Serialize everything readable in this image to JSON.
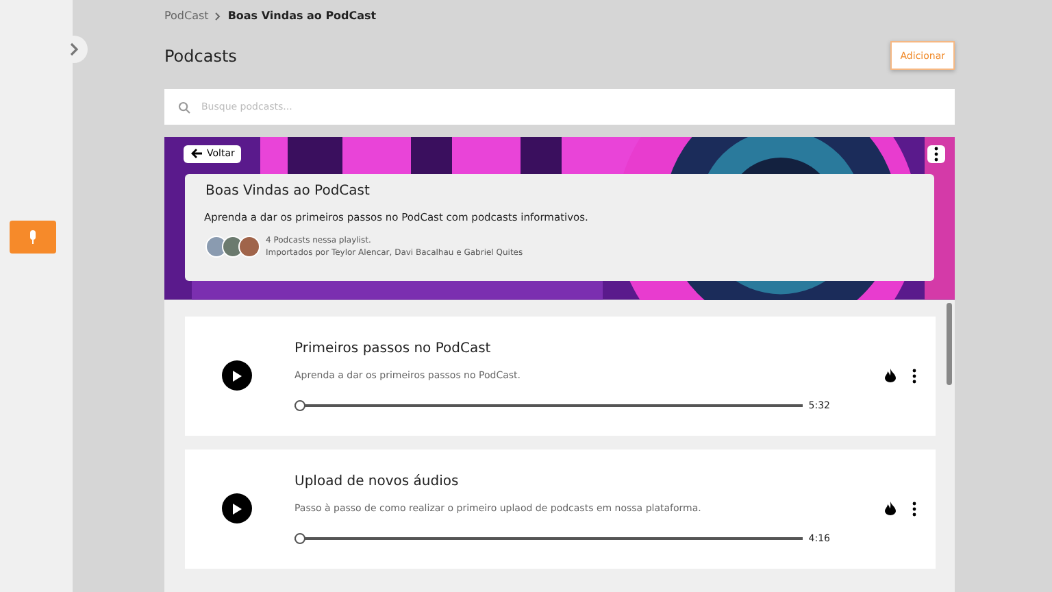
{
  "breadcrumb": [
    {
      "label": "PodCast",
      "selected": false
    },
    {
      "label": "Boas Vindas ao PodCast",
      "selected": true
    }
  ],
  "page_title": "Podcasts",
  "add_button": "Adicionar",
  "search": {
    "placeholder": "Busque podcasts..."
  },
  "playlist": {
    "back_button": "Voltar",
    "title": "Boas Vindas ao PodCast",
    "description": "Aprenda a dar os primeiros passos no PodCast com podcasts informativos.",
    "count": "4 Podcasts nessa playlist.",
    "importers": "Importados por Teylor Alencar, Davi Bacalhau e Gabriel Quites",
    "avatars": [
      {
        "color": "#8a9bb0"
      },
      {
        "color": "#6b7a6e"
      },
      {
        "color": "#a0644a"
      }
    ]
  },
  "episodes": [
    {
      "title": "Primeiros passos no PodCast",
      "description": "Aprenda a dar os primeiros passos no PodCast.",
      "level": 0,
      "duration": "5:32"
    },
    {
      "title": "Upload de novos áudios",
      "description": "Passo à passo de como realizar o primeiro uplaod de podcasts em nossa plataforma.",
      "level": 0,
      "duration": "4:16"
    }
  ]
}
